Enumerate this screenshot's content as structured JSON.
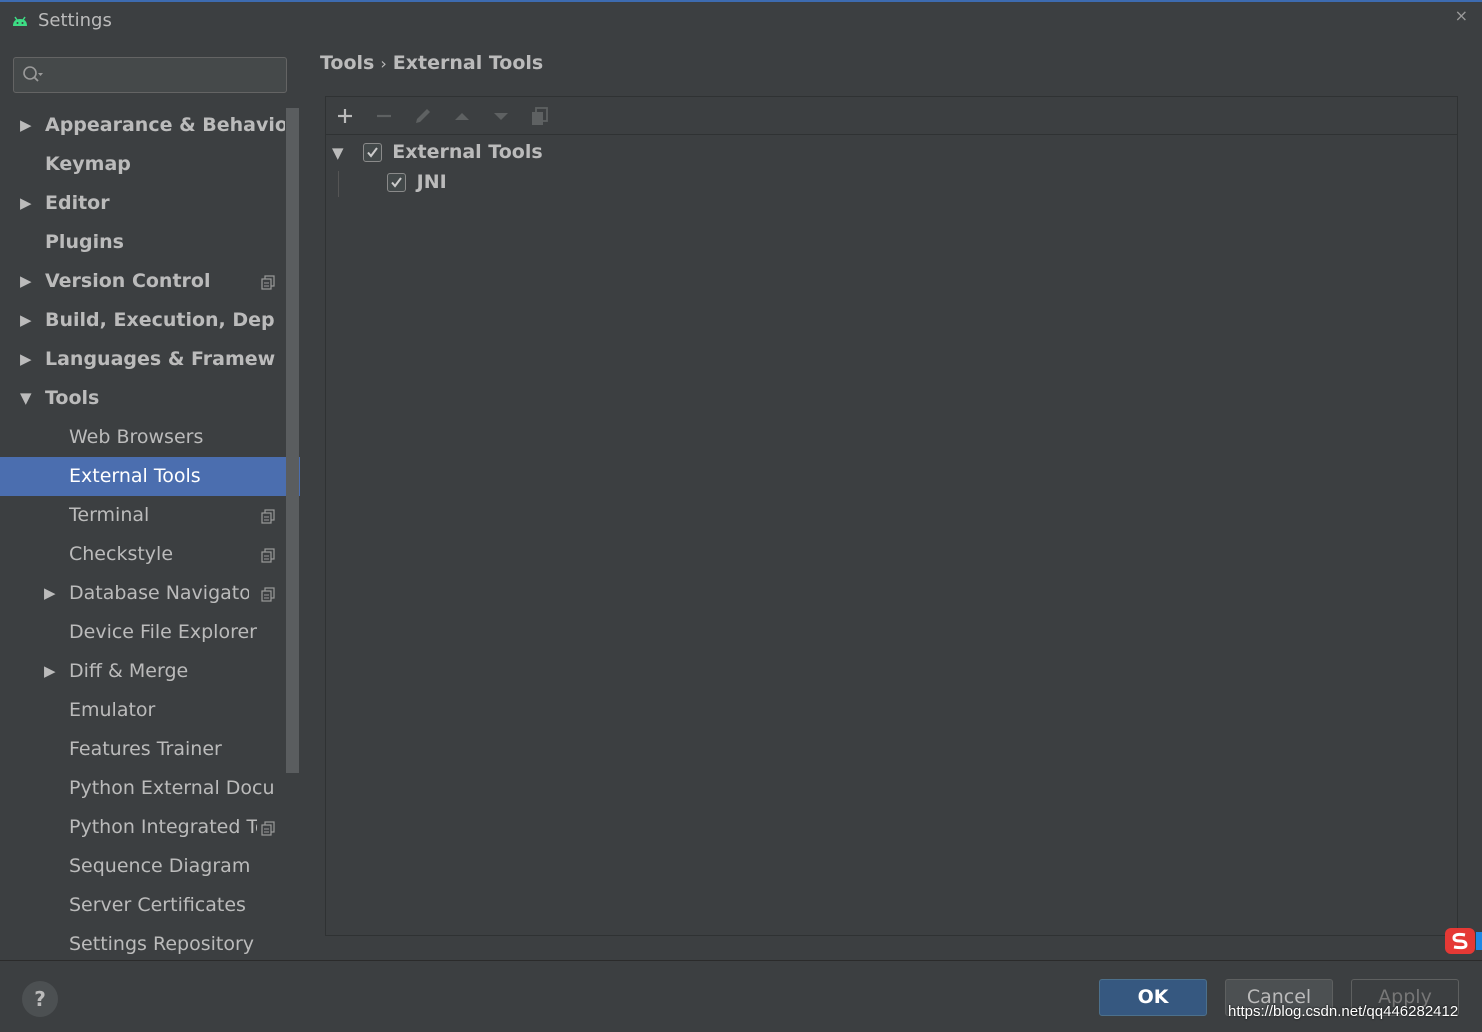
{
  "window": {
    "title": "Settings",
    "close": "×"
  },
  "search": {
    "placeholder": "",
    "value": ""
  },
  "sidebar": {
    "items": [
      {
        "label": "Appearance & Behavior",
        "expandable": true
      },
      {
        "label": "Keymap"
      },
      {
        "label": "Editor",
        "expandable": true
      },
      {
        "label": "Plugins"
      },
      {
        "label": "Version Control",
        "expandable": true
      },
      {
        "label": "Build, Execution, Deployment",
        "expandable": true
      },
      {
        "label": "Languages & Frameworks",
        "expandable": true
      },
      {
        "label": "Tools",
        "expanded": true
      },
      {
        "label": "Web Browsers"
      },
      {
        "label": "External Tools",
        "selected": true
      },
      {
        "label": "Terminal"
      },
      {
        "label": "Checkstyle"
      },
      {
        "label": "Database Navigator",
        "expandable": true
      },
      {
        "label": "Device File Explorer"
      },
      {
        "label": "Diff & Merge",
        "expandable": true
      },
      {
        "label": "Emulator"
      },
      {
        "label": "Features Trainer"
      },
      {
        "label": "Python External Documentation"
      },
      {
        "label": "Python Integrated Tools"
      },
      {
        "label": "Sequence Diagram"
      },
      {
        "label": "Server Certificates"
      },
      {
        "label": "Settings Repository"
      }
    ]
  },
  "breadcrumb": {
    "parent": "Tools",
    "separator": "›",
    "current": "External Tools"
  },
  "tools_tree": {
    "group": {
      "label": "External Tools",
      "checked": true
    },
    "children": [
      {
        "label": "JNI",
        "checked": true
      }
    ]
  },
  "footer": {
    "help": "?",
    "ok": "OK",
    "cancel": "Cancel",
    "apply": "Apply",
    "watermark": "https://blog.csdn.net/qq446282412"
  },
  "colors": {
    "background": "#3c3f41",
    "selection": "#4b6eaf",
    "ok_button": "#365880",
    "android_green": "#3ddc84"
  }
}
